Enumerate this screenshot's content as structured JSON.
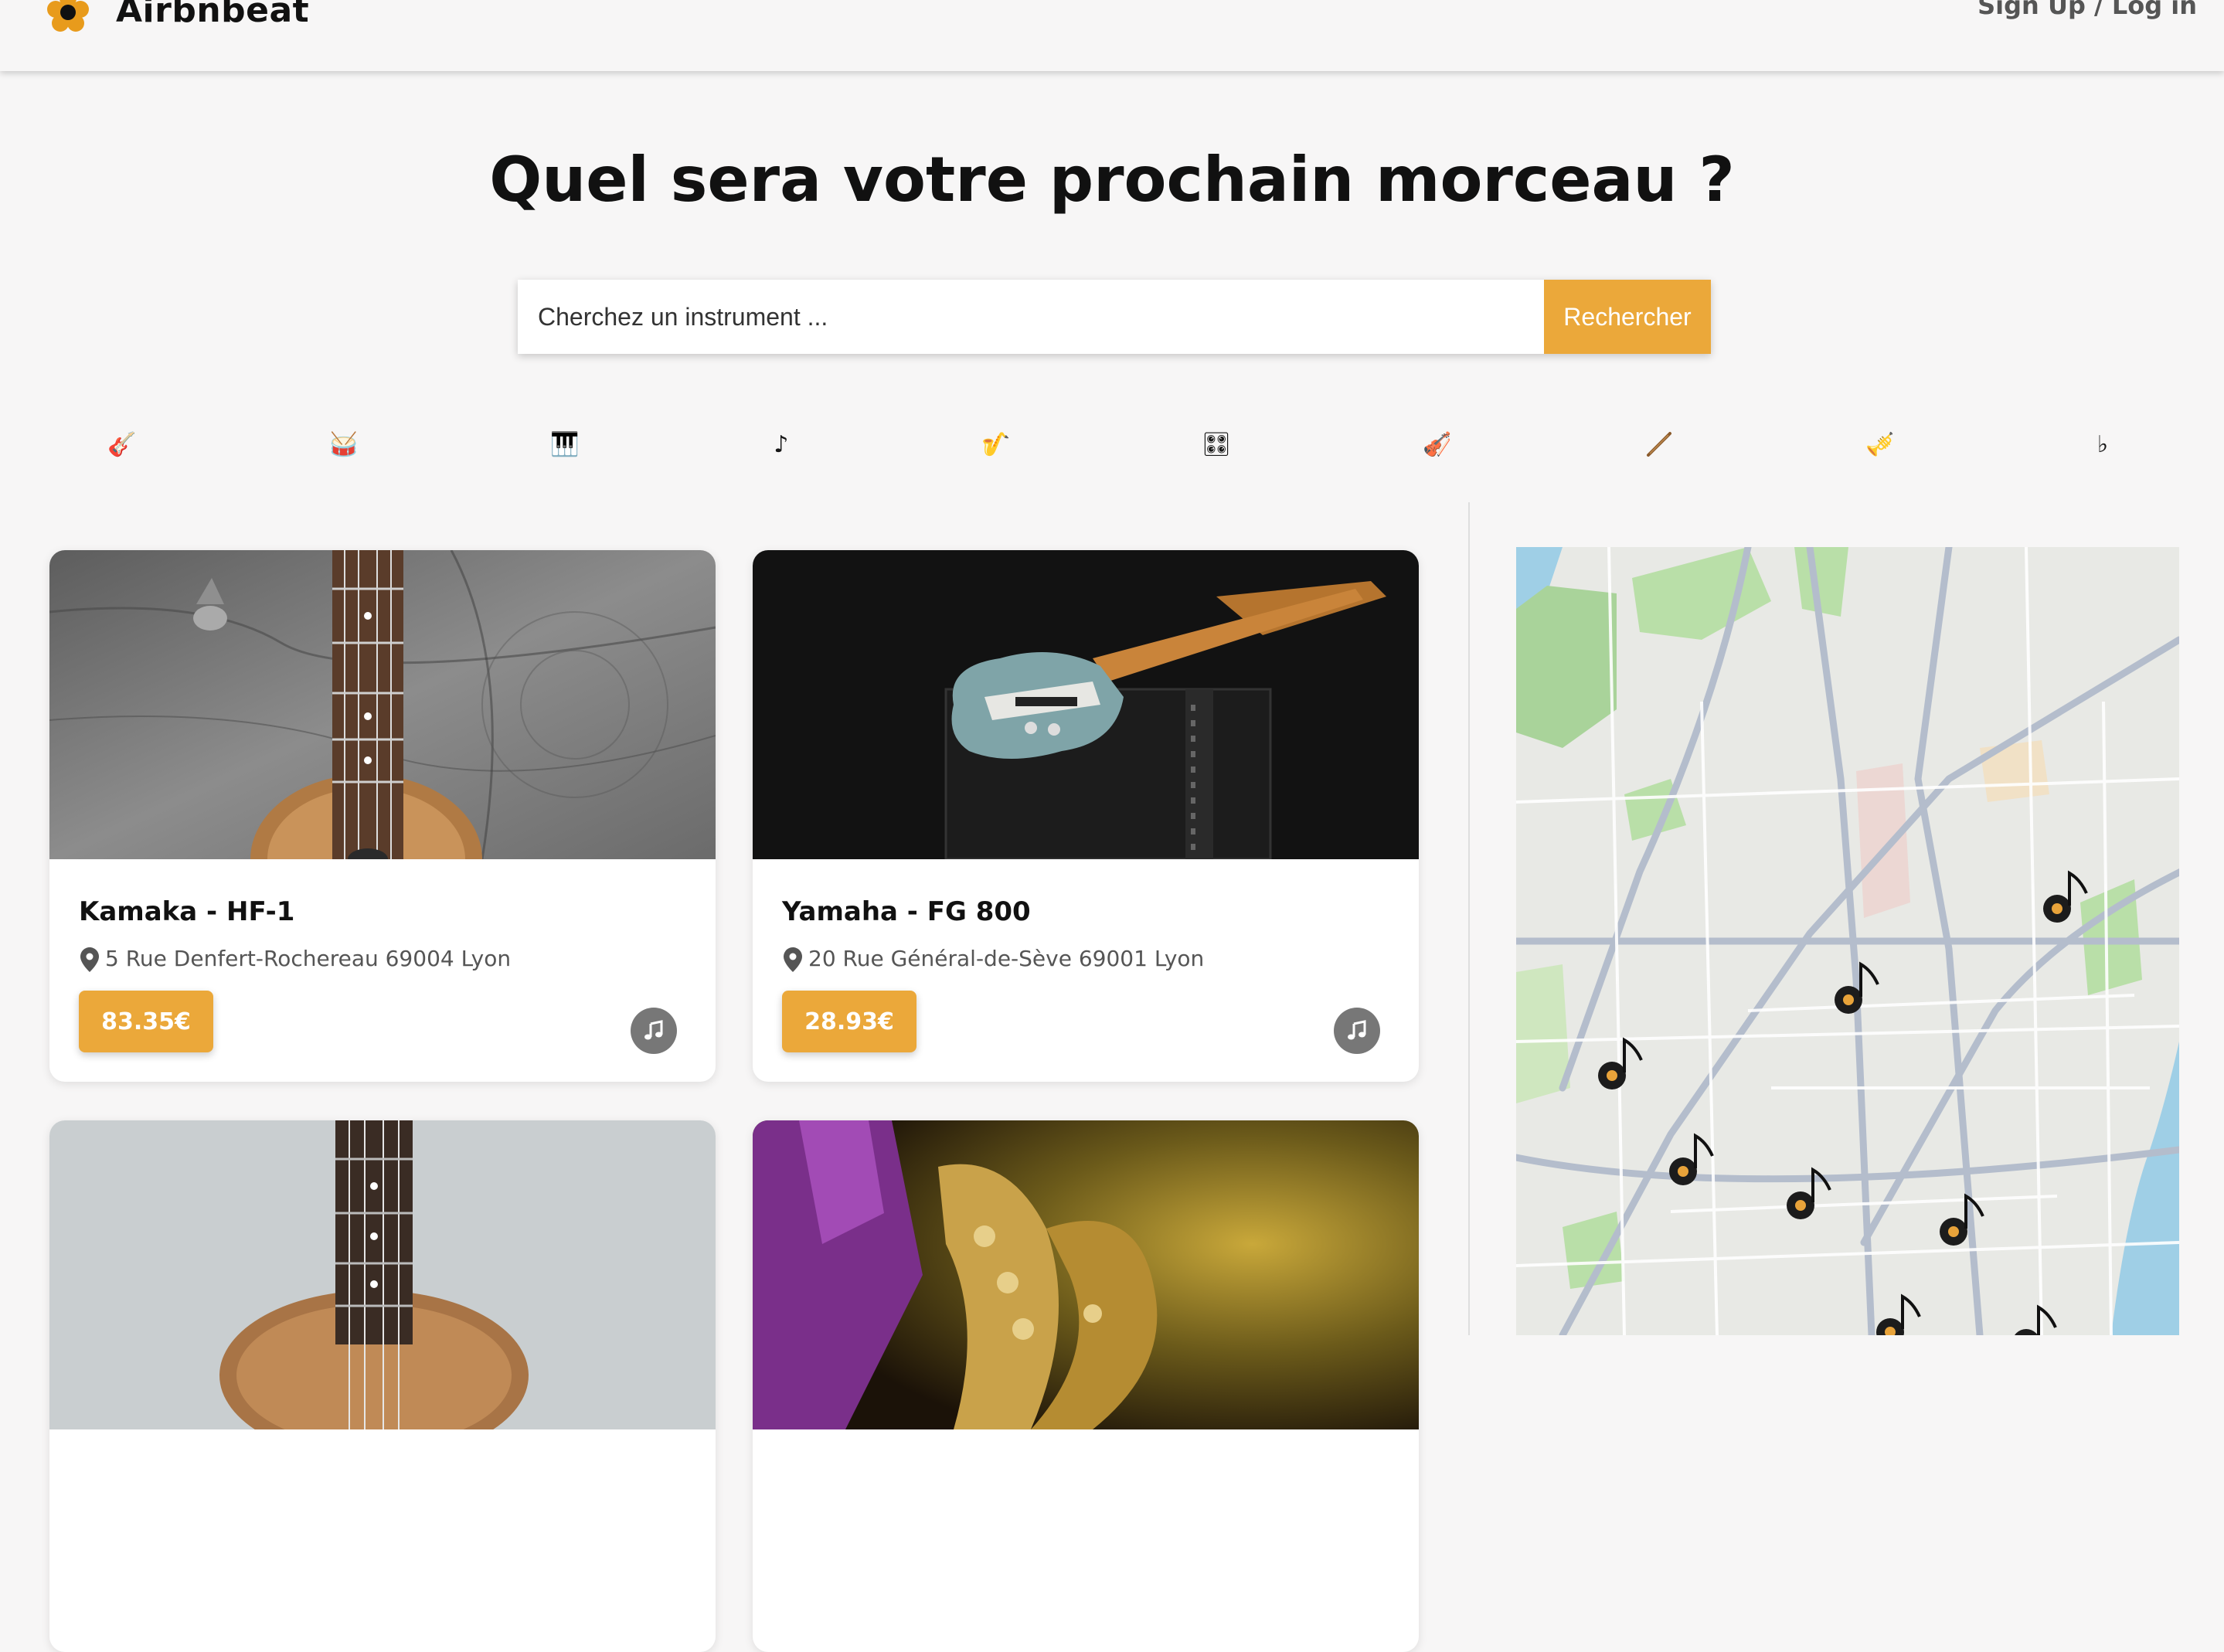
{
  "navbar": {
    "brand": "Airbnbeat",
    "auth_link": "Sign Up / Log in",
    "logo_icon": "flower-icon"
  },
  "hero": {
    "title": "Quel sera votre prochain morceau ?"
  },
  "search": {
    "placeholder": "Cherchez un instrument ...",
    "button_label": "Rechercher"
  },
  "categories": [
    {
      "icon": "electric-guitar-icon",
      "glyph": "🎸"
    },
    {
      "icon": "drum-icon",
      "glyph": "🥁"
    },
    {
      "icon": "piano-keys-icon",
      "glyph": "🎹"
    },
    {
      "icon": "music-note-icon",
      "glyph": "♪"
    },
    {
      "icon": "saxophone-icon",
      "glyph": "🎷"
    },
    {
      "icon": "control-knobs-icon",
      "glyph": "🎛"
    },
    {
      "icon": "violin-icon",
      "glyph": "🎻"
    },
    {
      "icon": "flute-icon",
      "glyph": "／"
    },
    {
      "icon": "trumpet-icon",
      "glyph": "🎺"
    },
    {
      "icon": "flat-sign-icon",
      "glyph": "♭"
    }
  ],
  "listings": [
    {
      "title": "Kamaka - HF-1",
      "address": "5 Rue Denfert-Rochereau 69004 Lyon",
      "price": "83.35€",
      "image": "ukulele-on-wood-photo"
    },
    {
      "title": "Yamaha - FG 800",
      "address": "20 Rue Général-de-Sève 69001 Lyon",
      "price": "28.93€",
      "image": "electric-guitar-on-amp-photo"
    },
    {
      "title": "",
      "address": "",
      "price": "",
      "image": "ukulele-grey-wall-photo"
    },
    {
      "title": "",
      "address": "",
      "price": "",
      "image": "saxophone-player-photo"
    }
  ],
  "colors": {
    "accent": "#eba83a",
    "background": "#f7f6f6",
    "text": "#161616",
    "muted_icon": "#777777"
  }
}
